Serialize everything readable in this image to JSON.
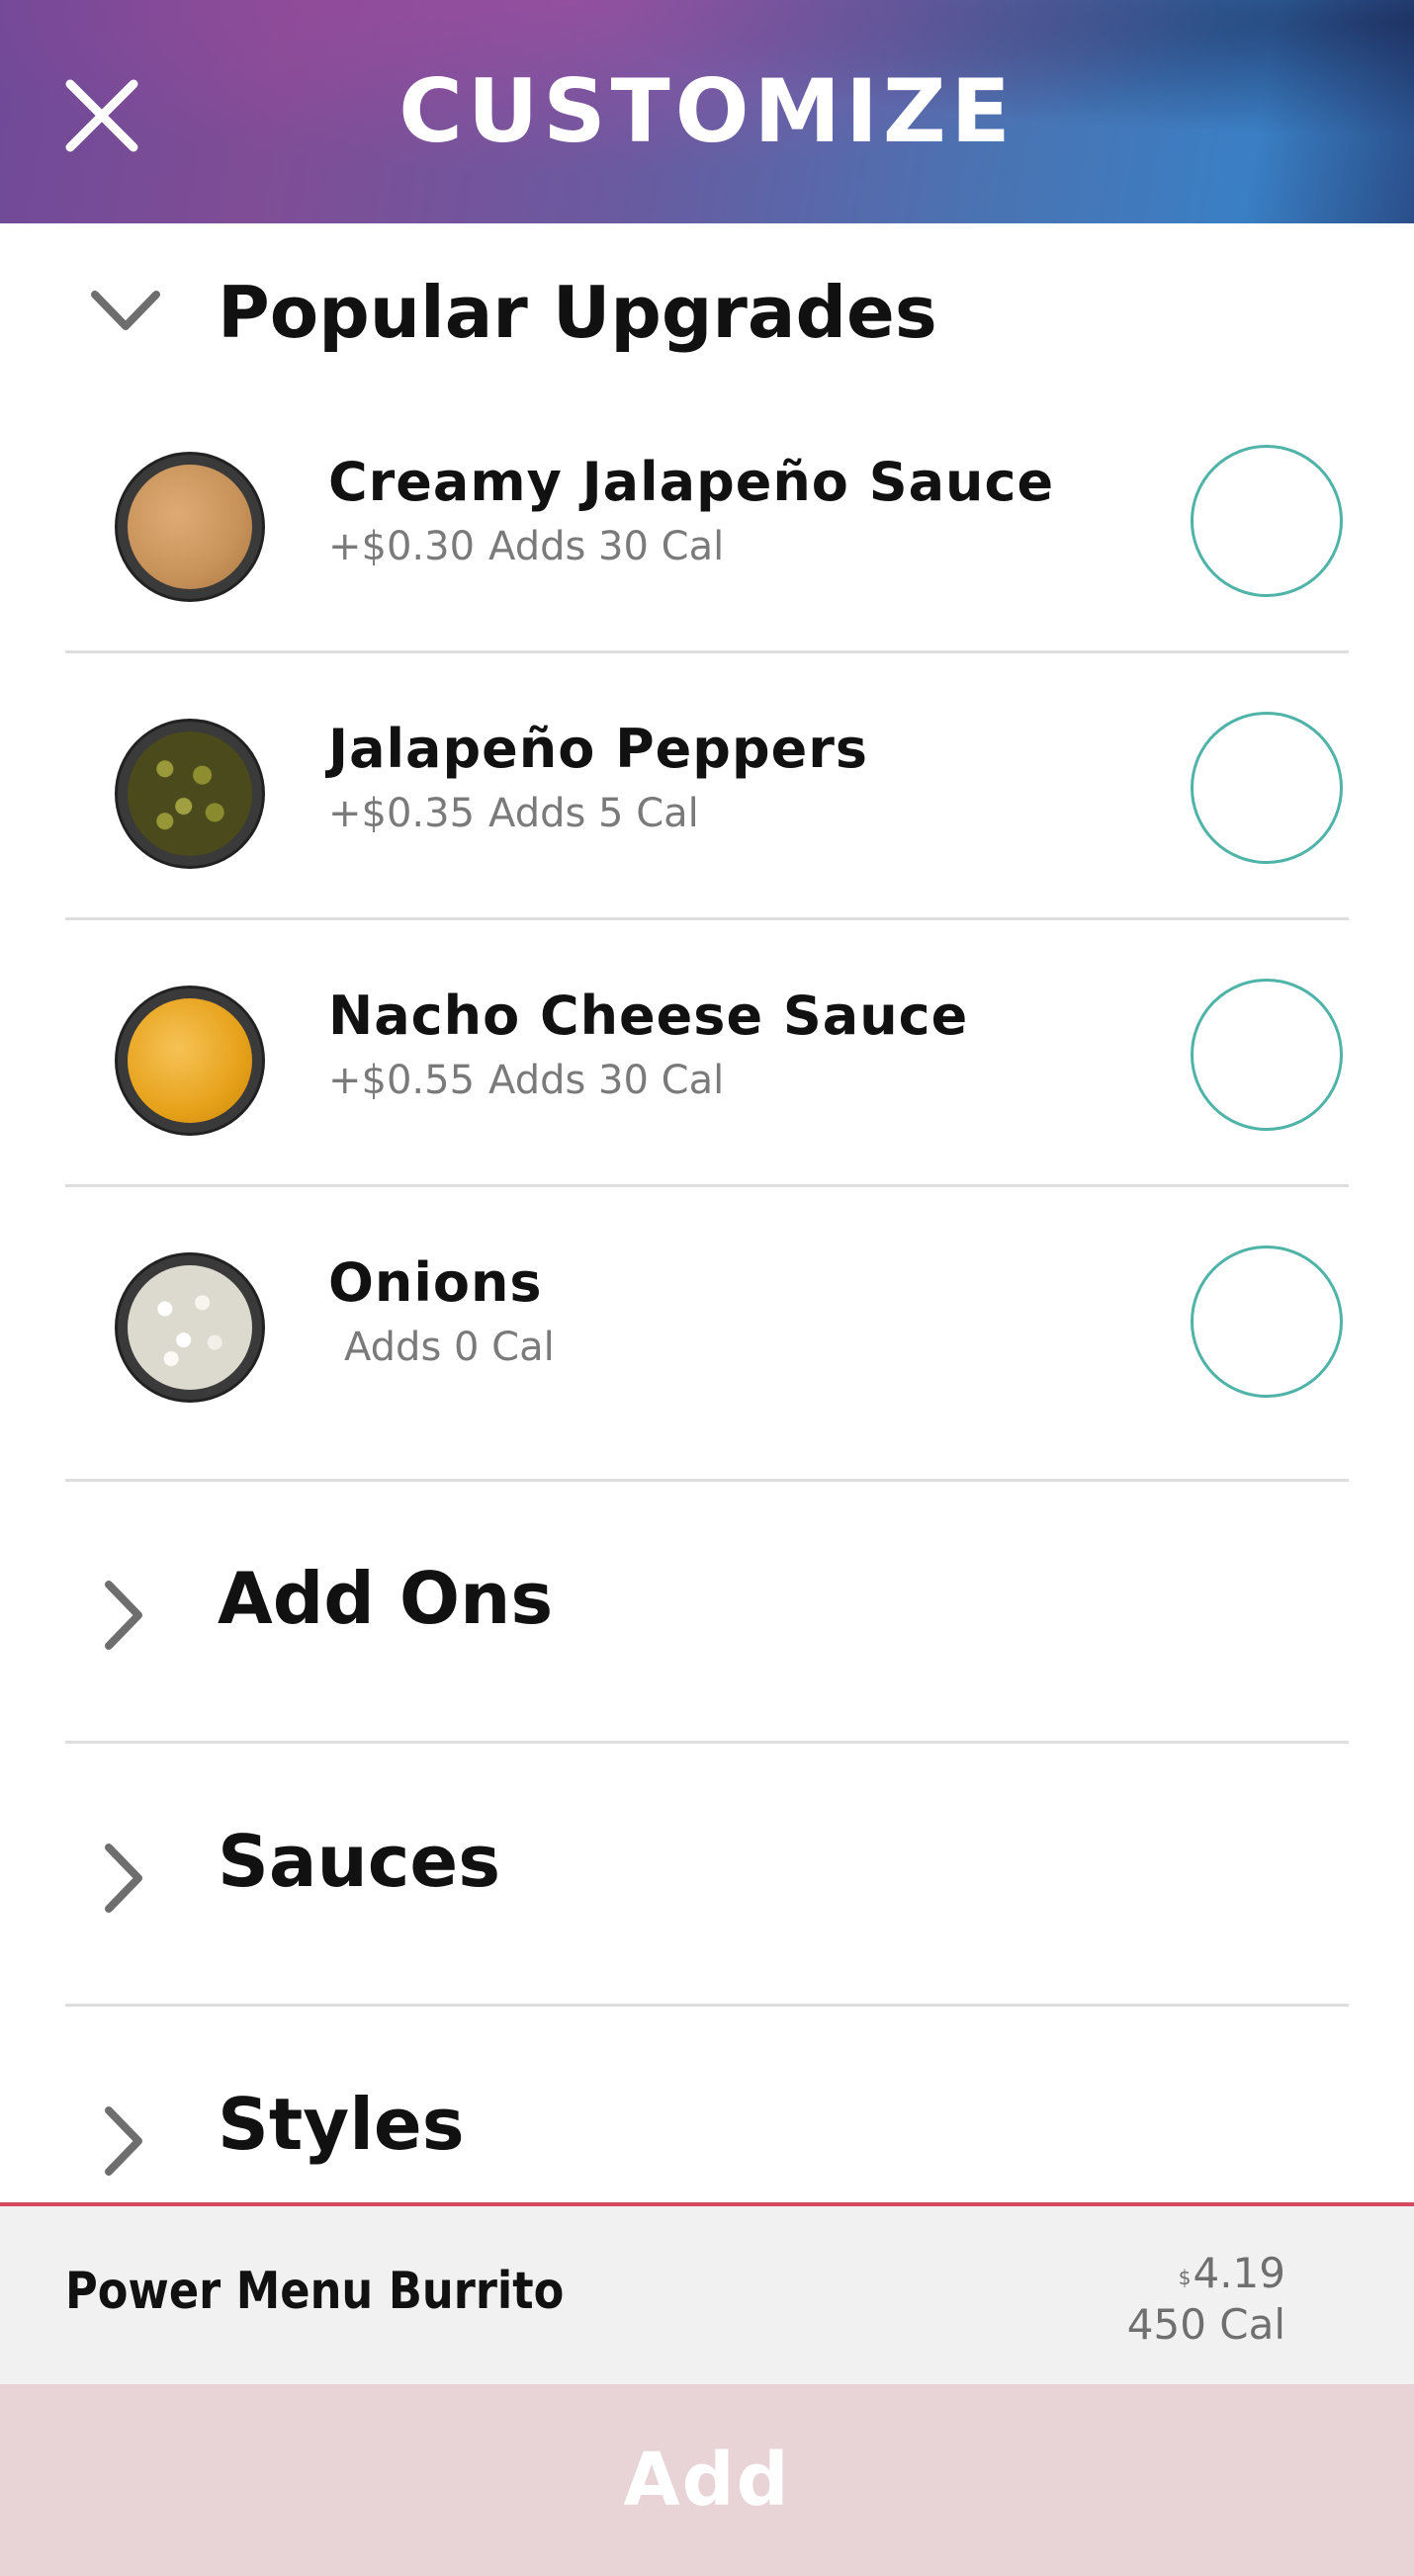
{
  "header": {
    "title": "CUSTOMIZE",
    "close_icon": "close-icon",
    "gradient_colors": [
      "#7f4d96",
      "#4a73b2",
      "#3a7fc4"
    ]
  },
  "popular_upgrades": {
    "title": "Popular Upgrades",
    "expanded": true,
    "items": [
      {
        "name": "Creamy Jalapeño Sauce",
        "price": "+$0.30",
        "calories": "Adds 30 Cal",
        "thumb_color": "#c7925a",
        "selected": false
      },
      {
        "name": "Jalapeño Peppers",
        "price": "+$0.35",
        "calories": "Adds 5 Cal",
        "thumb_color": "#5a5a22",
        "selected": false
      },
      {
        "name": "Nacho Cheese Sauce",
        "price": "+$0.55",
        "calories": "Adds 30 Cal",
        "thumb_color": "#e7a21b",
        "selected": false
      },
      {
        "name": "Onions",
        "price": "",
        "calories": "Adds 0 Cal",
        "thumb_color": "#e8e6df",
        "selected": false
      }
    ]
  },
  "collapsed_sections": [
    {
      "title": "Add Ons"
    },
    {
      "title": "Sauces"
    },
    {
      "title": "Styles"
    }
  ],
  "footer": {
    "product_name": "Power Menu Burrito",
    "price_symbol": "$",
    "price": "4.19",
    "calories": "450 Cal",
    "accent_color": "#d3495e"
  },
  "add_button": {
    "label": "Add",
    "background": "#e8d3d6"
  },
  "colors": {
    "radio_border": "#4fb3a8",
    "divider": "#dedede"
  }
}
